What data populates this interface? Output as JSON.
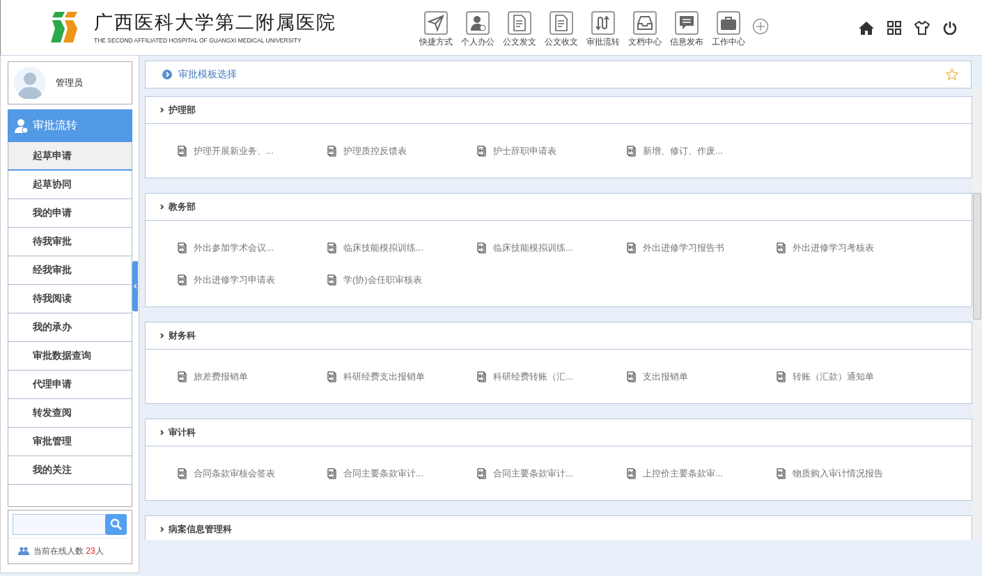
{
  "header": {
    "title": "广西医科大学第二附属医院",
    "subtitle": "THE SECOND AFFILIATED HOSPITAL OF GUANGXI MEDICAL UNIVERSITY",
    "nav": [
      {
        "label": "快捷方式"
      },
      {
        "label": "个人办公"
      },
      {
        "label": "公文发文"
      },
      {
        "label": "公文收文"
      },
      {
        "label": "审批流转"
      },
      {
        "label": "文档中心"
      },
      {
        "label": "信息发布"
      },
      {
        "label": "工作中心"
      }
    ]
  },
  "sidebar": {
    "user": "管理员",
    "module": "审批流转",
    "items": [
      {
        "label": "起草申请",
        "selected": true
      },
      {
        "label": "起草协同",
        "selected": false
      },
      {
        "label": "我的申请",
        "selected": false
      },
      {
        "label": "待我审批",
        "selected": false
      },
      {
        "label": "经我审批",
        "selected": false
      },
      {
        "label": "待我阅读",
        "selected": false
      },
      {
        "label": "我的承办",
        "selected": false
      },
      {
        "label": "审批数据查询",
        "selected": false
      },
      {
        "label": "代理申请",
        "selected": false
      },
      {
        "label": "转发查阅",
        "selected": false
      },
      {
        "label": "审批管理",
        "selected": false
      },
      {
        "label": "我的关注",
        "selected": false
      }
    ],
    "online_label": "当前在线人数",
    "online_count": "23",
    "online_unit": "人"
  },
  "breadcrumb": "审批模板选择",
  "sections": [
    {
      "title": "护理部",
      "items": [
        "护理开展新业务、...",
        "护理质控反馈表",
        "护士辞职申请表",
        "新增、修订、作废..."
      ]
    },
    {
      "title": "教务部",
      "items": [
        "外出参加学术会议...",
        "临床技能模拟训练...",
        "临床技能模拟训练...",
        "外出进修学习报告书",
        "外出进修学习考核表",
        "外出进修学习申请表",
        "学(协)会任职审核表"
      ]
    },
    {
      "title": "财务科",
      "items": [
        "旅差费报销单",
        "科研经费支出报销单",
        "科研经费转账（汇...",
        "支出报销单",
        "转账（汇款）通知单"
      ]
    },
    {
      "title": "审计科",
      "items": [
        "合同条款审核会签表",
        "合同主要条款审计...",
        "合同主要条款审计...",
        "上控价主要条款审...",
        "物质购入审计情况报告"
      ]
    },
    {
      "title": "病案信息管理科"
    }
  ]
}
